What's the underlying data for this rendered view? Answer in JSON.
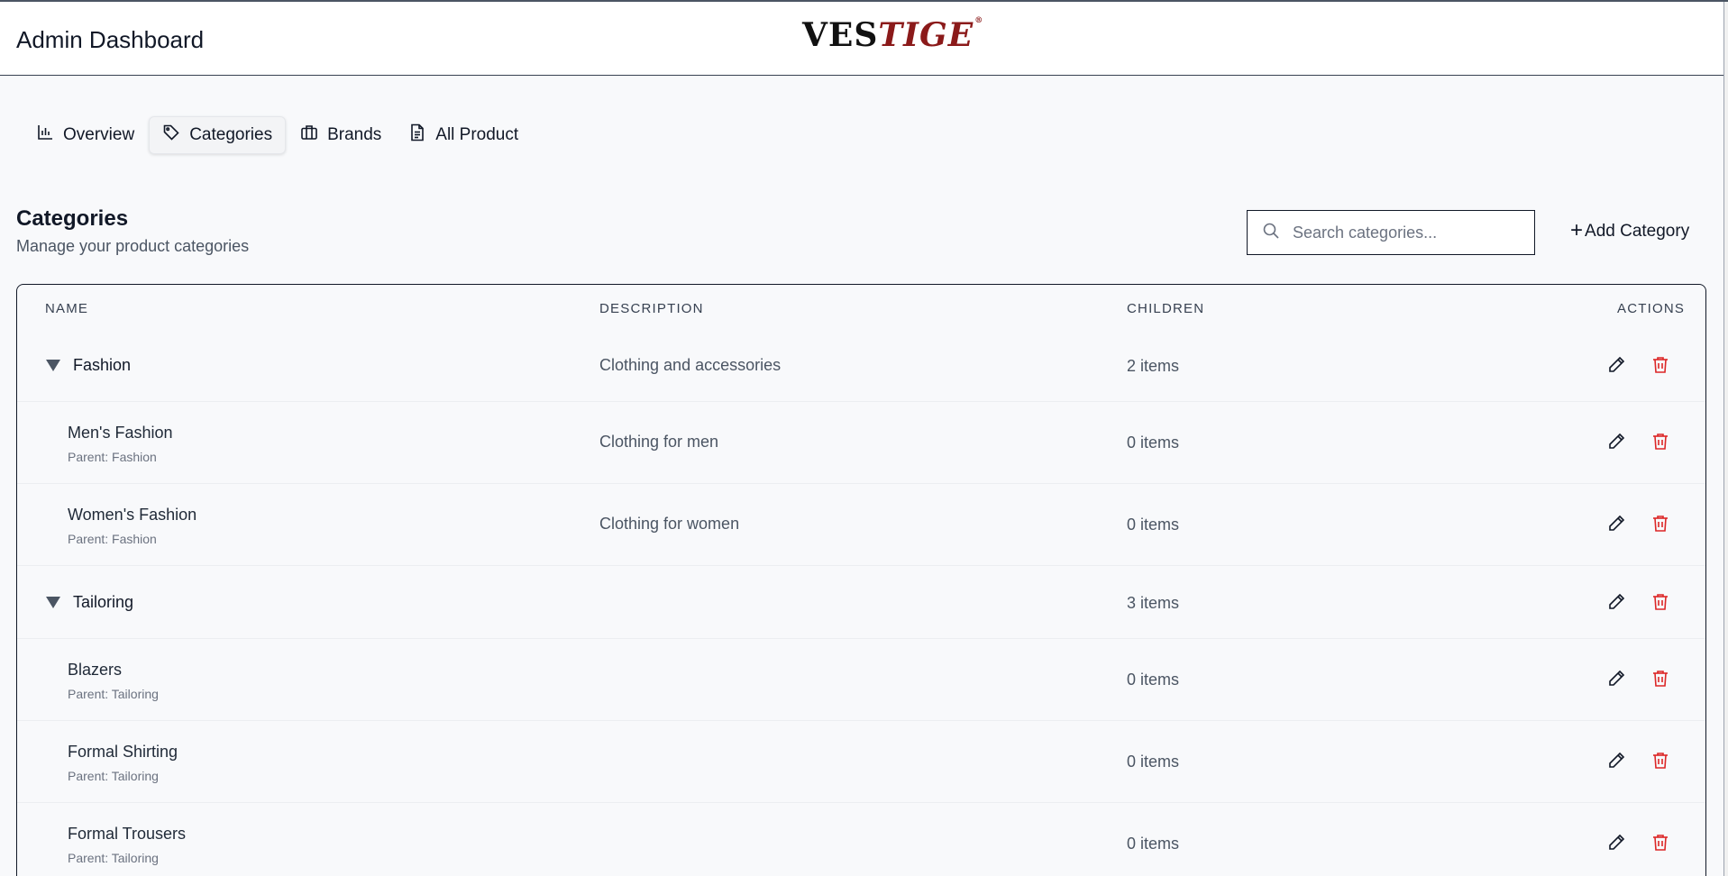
{
  "header": {
    "title": "Admin Dashboard",
    "logo_text_a": "VES",
    "logo_text_b": "TIGE",
    "logo_mark": "®"
  },
  "tabs": [
    {
      "label": "Overview",
      "icon": "bar-chart-icon"
    },
    {
      "label": "Categories",
      "icon": "tag-icon"
    },
    {
      "label": "Brands",
      "icon": "briefcase-icon"
    },
    {
      "label": "All Product",
      "icon": "document-icon"
    }
  ],
  "section": {
    "title": "Categories",
    "subtitle": "Manage your product categories",
    "search_placeholder": "Search categories...",
    "add_label": "Add Category",
    "add_plus": "+"
  },
  "table": {
    "headers": {
      "name": "Name",
      "description": "Description",
      "children": "Children",
      "actions": "Actions"
    },
    "rows": [
      {
        "type": "parent",
        "name": "Fashion",
        "description": "Clothing and accessories",
        "children": "2 items"
      },
      {
        "type": "child",
        "name": "Men's Fashion",
        "parent": "Parent: Fashion",
        "description": "Clothing for men",
        "children": "0 items"
      },
      {
        "type": "child",
        "name": "Women's Fashion",
        "parent": "Parent: Fashion",
        "description": "Clothing for women",
        "children": "0 items"
      },
      {
        "type": "parent",
        "name": "Tailoring",
        "description": "",
        "children": "3 items"
      },
      {
        "type": "child",
        "name": "Blazers",
        "parent": "Parent: Tailoring",
        "description": "",
        "children": "0 items"
      },
      {
        "type": "child",
        "name": "Formal Shirting",
        "parent": "Parent: Tailoring",
        "description": "",
        "children": "0 items"
      },
      {
        "type": "child",
        "name": "Formal Trousers",
        "parent": "Parent: Tailoring",
        "description": "",
        "children": "0 items"
      }
    ]
  },
  "colors": {
    "logo_dark": "#111111",
    "logo_red": "#8b1a1a",
    "delete_red": "#dc2626",
    "page_bg": "#f8f9fb"
  }
}
